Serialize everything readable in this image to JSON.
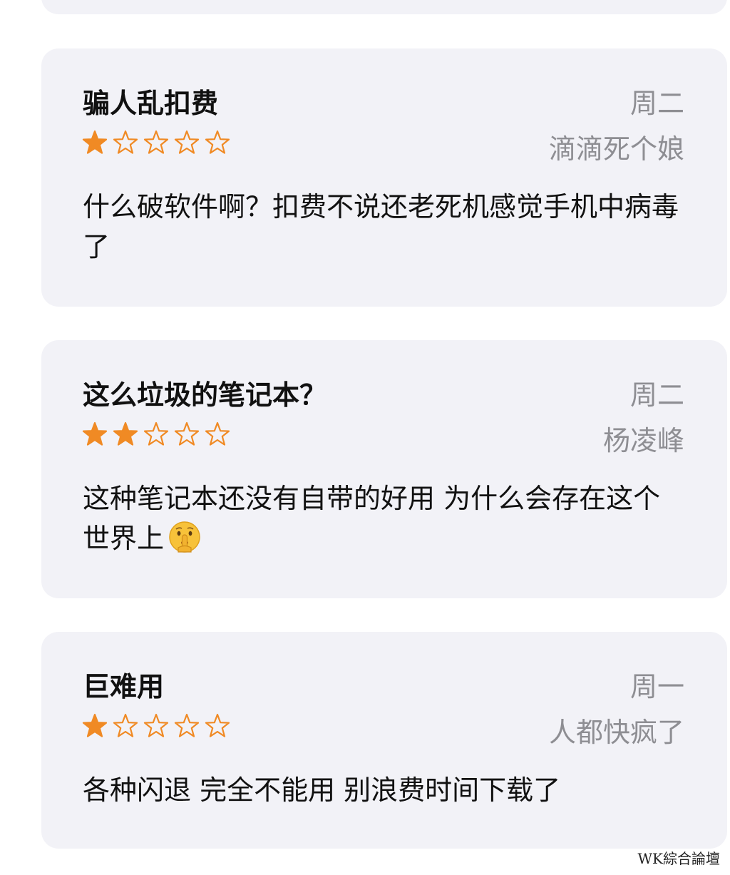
{
  "reviews": [
    {
      "title": "骗人乱扣费",
      "date": "周二",
      "author": "滴滴死个娘",
      "rating": 1,
      "rating_max": 5,
      "body": "什么破软件啊？扣费不说还老死机感觉手机中病毒了"
    },
    {
      "title": "这么垃圾的笔记本？",
      "date": "周二",
      "author": "杨凌峰",
      "rating": 2,
      "rating_max": 5,
      "body": "这种笔记本还没有自带的好用 为什么会存在这个世界上",
      "emoji": "shushing-face-icon"
    },
    {
      "title": "巨难用",
      "date": "周一",
      "author": "人都快疯了",
      "rating": 1,
      "rating_max": 5,
      "body": "各种闪退 完全不能用 别浪费时间下载了"
    }
  ],
  "watermark": "WK綜合論壇",
  "colors": {
    "star": "#f08a24",
    "card_bg": "#f2f2f7",
    "secondary_text": "#8e8e93"
  }
}
